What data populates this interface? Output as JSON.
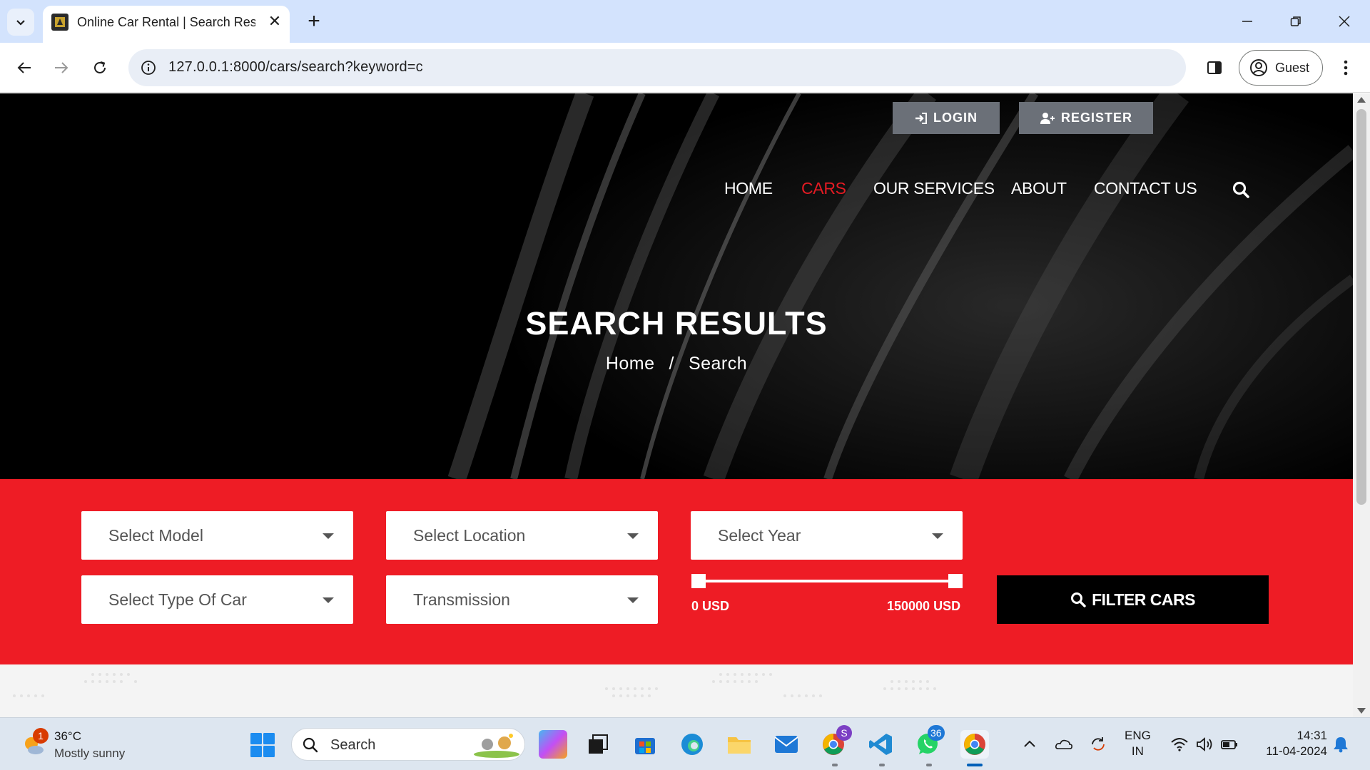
{
  "browser": {
    "tab_title": "Online Car Rental | Search Results",
    "new_tab": "+",
    "url": "127.0.0.1:8000/cars/search?keyword=c",
    "profile_label": "Guest"
  },
  "header": {
    "login_label": "LOGIN",
    "register_label": "REGISTER",
    "nav": [
      "HOME",
      "CARS",
      "OUR SERVICES",
      "ABOUT",
      "CONTACT US"
    ],
    "active_nav": "CARS"
  },
  "hero": {
    "title": "SEARCH RESULTS",
    "breadcrumb": [
      "Home",
      "/",
      "Search"
    ]
  },
  "filter": {
    "model": "Select Model",
    "location": "Select Location",
    "year": "Select Year",
    "type": "Select Type Of Car",
    "transmission": "Transmission",
    "price_min": "0 USD",
    "price_max": "150000 USD",
    "button_label": "FILTER CARS"
  },
  "taskbar": {
    "weather_badge": "1",
    "temperature": "36°C",
    "weather": "Mostly sunny",
    "search_label": "Search",
    "teams_badge": "S",
    "whatsapp_badge": "36",
    "language": "ENG",
    "region": "IN",
    "time": "14:31",
    "date": "11-04-2024"
  },
  "colors": {
    "accent_red": "#ee1c25",
    "nav_active": "#e31b23",
    "header_button": "#6b7078",
    "tabbar": "#d3e3fd"
  }
}
